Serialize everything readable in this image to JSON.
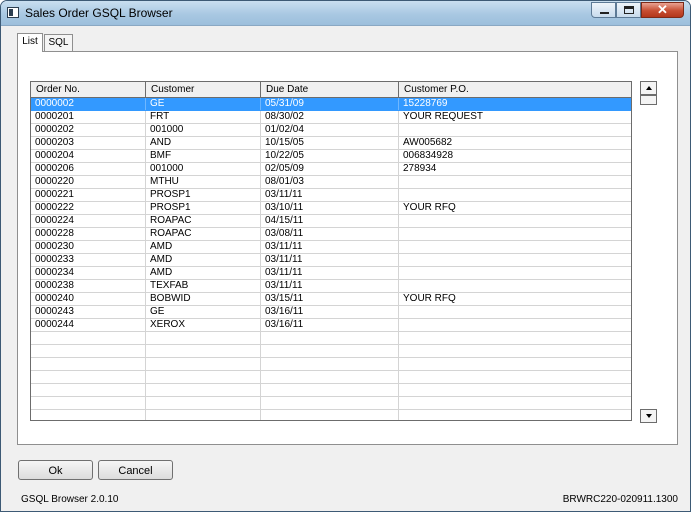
{
  "window": {
    "title": "Sales Order GSQL Browser"
  },
  "tabs": [
    {
      "label": "List",
      "active": true
    },
    {
      "label": "SQL",
      "active": false
    }
  ],
  "grid": {
    "columns": [
      "Order No.",
      "Customer",
      "Due Date",
      "Customer P.O."
    ],
    "selected_index": 0,
    "rows": [
      [
        "0000002",
        "GE",
        "05/31/09",
        "15228769"
      ],
      [
        "0000201",
        "FRT",
        "08/30/02",
        "YOUR REQUEST"
      ],
      [
        "0000202",
        "001000",
        "01/02/04",
        ""
      ],
      [
        "0000203",
        "AND",
        "10/15/05",
        "AW005682"
      ],
      [
        "0000204",
        "BMF",
        "10/22/05",
        "006834928"
      ],
      [
        "0000206",
        "001000",
        "02/05/09",
        "278934"
      ],
      [
        "0000220",
        "MTHU",
        "08/01/03",
        ""
      ],
      [
        "0000221",
        "PROSP1",
        "03/11/11",
        ""
      ],
      [
        "0000222",
        "PROSP1",
        "03/10/11",
        "YOUR RFQ"
      ],
      [
        "0000224",
        "ROAPAC",
        "04/15/11",
        ""
      ],
      [
        "0000228",
        "ROAPAC",
        "03/08/11",
        ""
      ],
      [
        "0000230",
        "AMD",
        "03/11/11",
        ""
      ],
      [
        "0000233",
        "AMD",
        "03/11/11",
        ""
      ],
      [
        "0000234",
        "AMD",
        "03/11/11",
        ""
      ],
      [
        "0000238",
        "TEXFAB",
        "03/11/11",
        ""
      ],
      [
        "0000240",
        "BOBWID",
        "03/15/11",
        "YOUR RFQ"
      ],
      [
        "0000243",
        "GE",
        "03/16/11",
        ""
      ],
      [
        "0000244",
        "XEROX",
        "03/16/11",
        ""
      ]
    ],
    "empty_rows": 7
  },
  "buttons": {
    "ok": "Ok",
    "cancel": "Cancel"
  },
  "status": {
    "left": "GSQL Browser 2.0.10",
    "right": "BRWRC220-020911.1300"
  },
  "colors": {
    "selection": "#3399ff",
    "titlebar": "#a9c8e2",
    "close": "#c74e32"
  }
}
